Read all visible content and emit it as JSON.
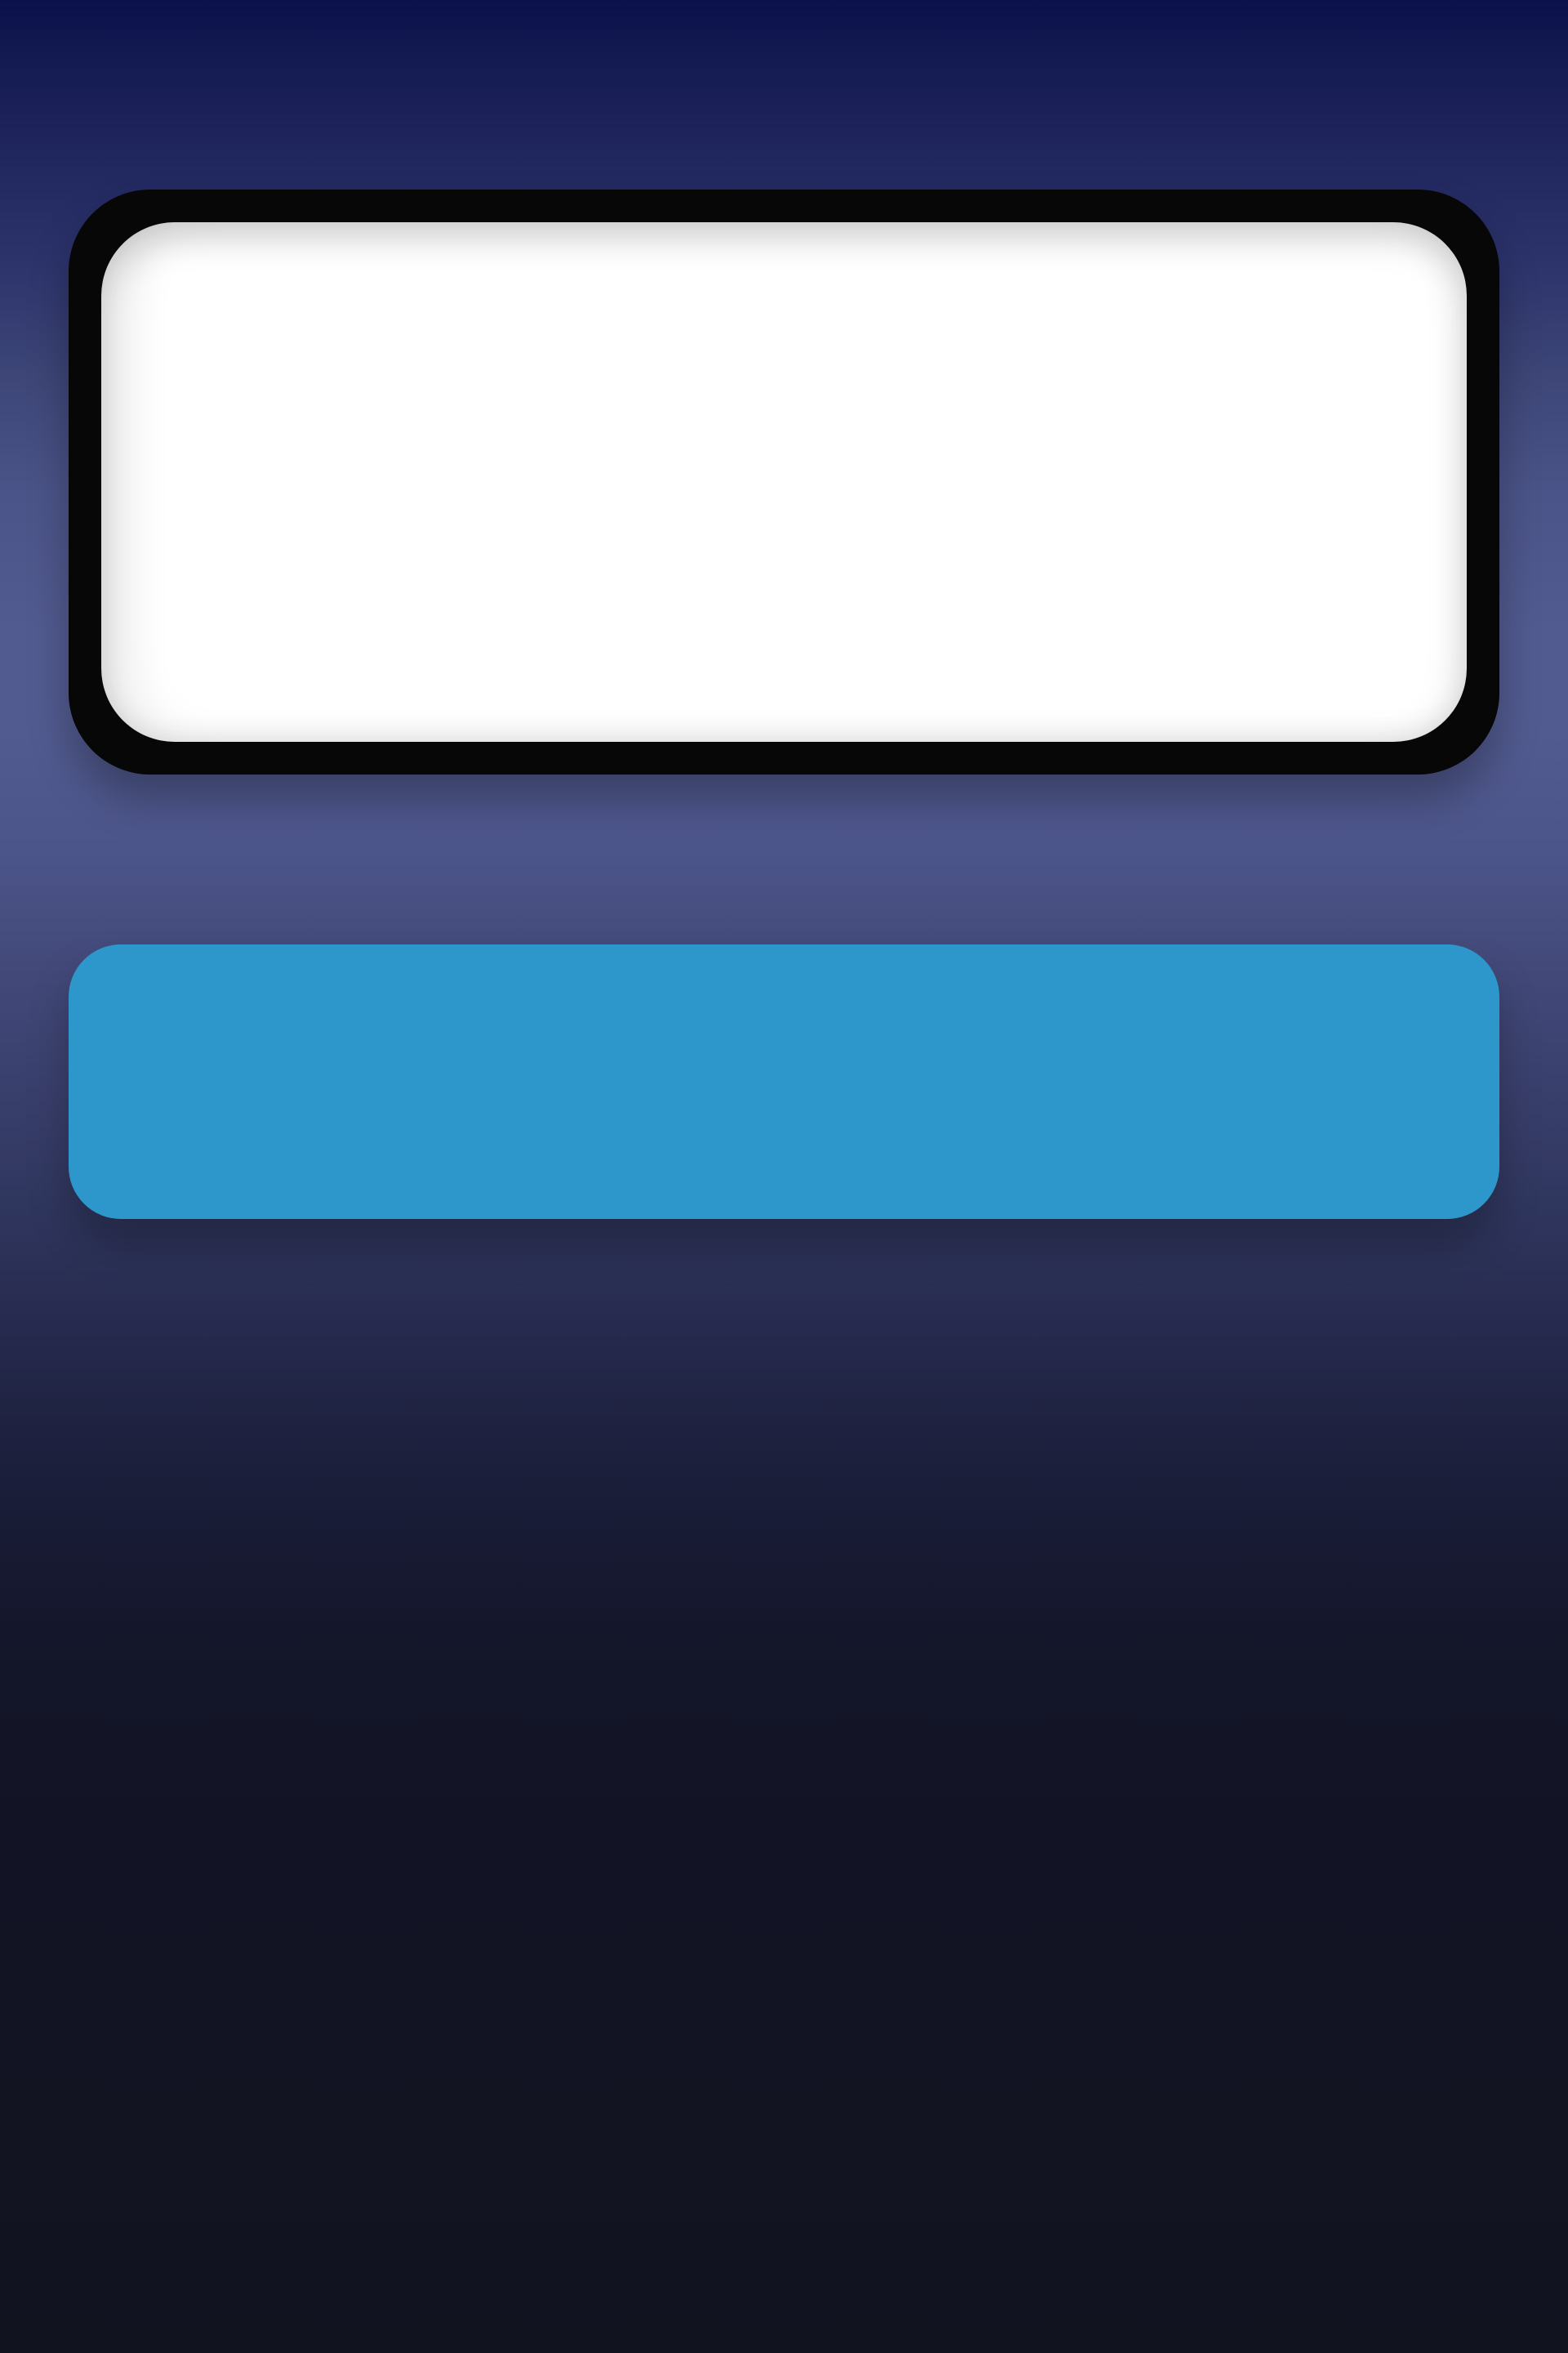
{
  "display": {
    "value": ""
  },
  "button": {
    "label": ""
  },
  "colors": {
    "background_top": "#0b114a",
    "background_mid": "#525b90",
    "background_bottom": "#11131f",
    "display_bezel": "#070707",
    "display_screen": "#ffffff",
    "button": "#2d97cb"
  }
}
